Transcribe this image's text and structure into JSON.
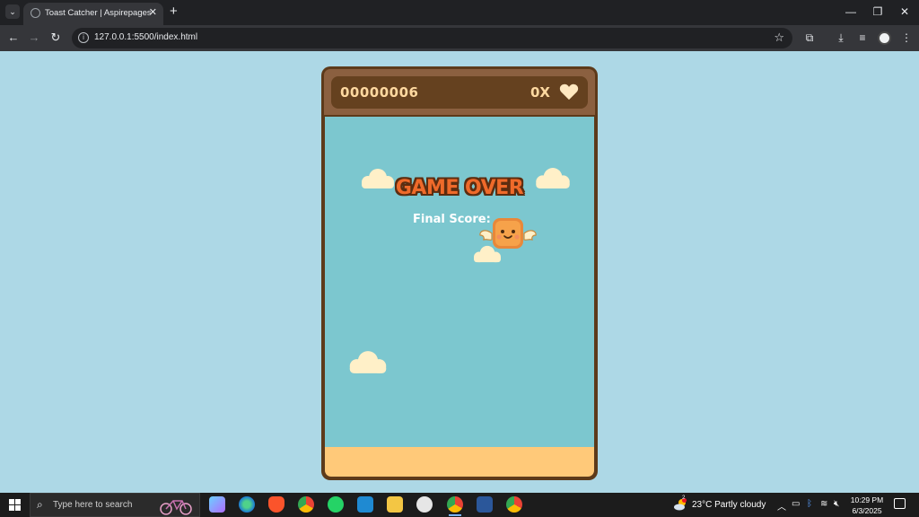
{
  "browser": {
    "tab_title": "Toast Catcher | Aspirepages",
    "url": "127.0.0.1:5500/index.html"
  },
  "game": {
    "score": "00000006",
    "lives": "0X",
    "title": "GAME OVER",
    "final_score_label": "Final Score:"
  },
  "taskbar": {
    "search_placeholder": "Type here to search",
    "weather": "23°C  Partly cloudy",
    "weather_badge": "2",
    "time": "10:29 PM",
    "date": "6/3/2025"
  },
  "colors": {
    "page_bg": "#add8e6",
    "sky": "#7cc7cf",
    "ground": "#ffc979",
    "frame": "#5d3a1a",
    "game_over": "#ef6a2a"
  }
}
